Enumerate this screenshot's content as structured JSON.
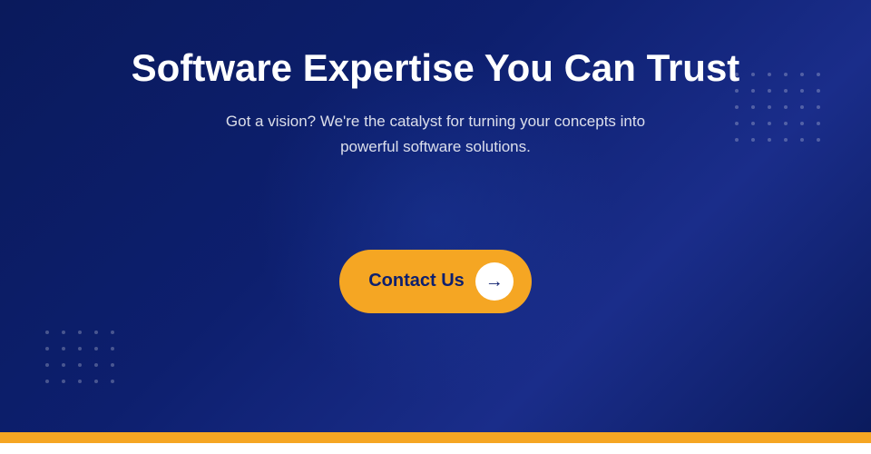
{
  "hero": {
    "title": "Software Expertise You Can Trust",
    "subtitle": "Got a vision? We're the catalyst for turning your concepts into powerful software solutions.",
    "cta_button_label": "Contact Us",
    "cta_arrow": "→",
    "background_color": "#0a1a5c",
    "accent_color": "#f5a623",
    "text_color": "#ffffff",
    "subtitle_color": "rgba(255,255,255,0.85)"
  },
  "bottom_bar": {
    "color": "#f5a623"
  }
}
